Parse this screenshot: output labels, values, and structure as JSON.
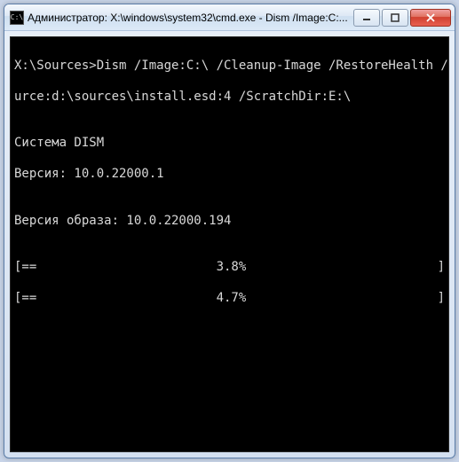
{
  "window": {
    "title": "Администратор: X:\\windows\\system32\\cmd.exe - Dism /Image:C:...",
    "icon_label": "C:\\"
  },
  "buttons": {
    "minimize": "minimize",
    "maximize": "maximize",
    "close": "close"
  },
  "terminal": {
    "prompt_line1": "X:\\Sources>Dism /Image:C:\\ /Cleanup-Image /RestoreHealth /So",
    "prompt_line2": "urce:d:\\sources\\install.esd:4 /ScratchDir:E:\\",
    "blank": "",
    "system_line": "Система DISM",
    "version_line": "Версия: 10.0.22000.1",
    "image_version_line": "Версия образа: 10.0.22000.194",
    "progress1": {
      "bar": "[==                        ",
      "pct": "3.8%",
      "end": "]"
    },
    "progress2": {
      "bar": "[==                        ",
      "pct": "4.7%",
      "end": "]"
    }
  }
}
